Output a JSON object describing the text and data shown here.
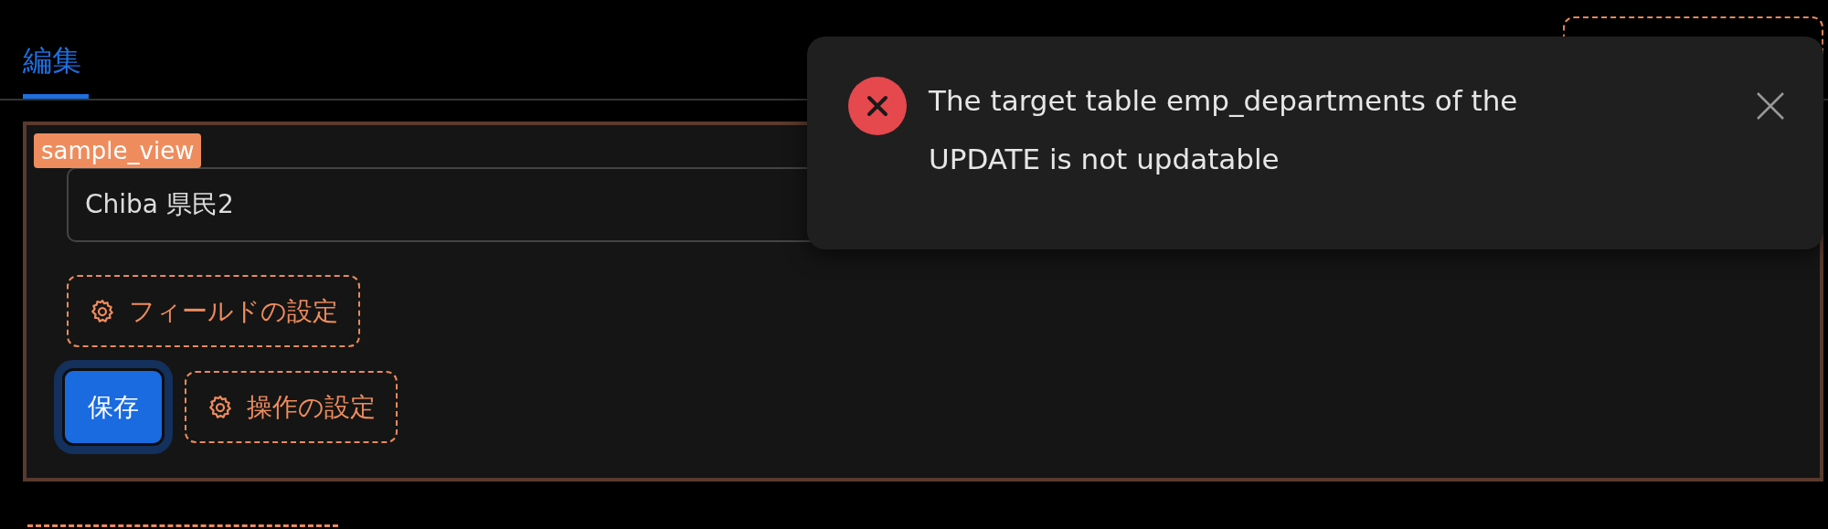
{
  "tabs": [
    {
      "label": "編集",
      "selected": true
    }
  ],
  "form": {
    "badge": "sample_view",
    "field": {
      "value": "Chiba 県民2"
    },
    "field_settings_button": "フィールドの設定",
    "save_button": "保存",
    "action_settings_button": "操作の設定"
  },
  "toast": {
    "kind": "error",
    "message": "The target table emp_departments of the UPDATE is not updatable"
  }
}
